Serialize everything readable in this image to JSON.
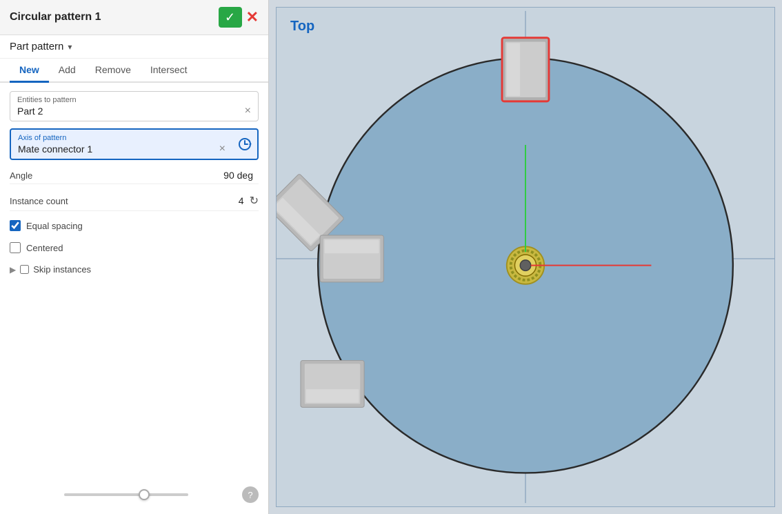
{
  "panel": {
    "title": "Circular pattern 1",
    "confirm_label": "✓",
    "cancel_label": "✗",
    "dropdown_label": "Part pattern",
    "tabs": [
      {
        "id": "new",
        "label": "New",
        "active": true
      },
      {
        "id": "add",
        "label": "Add",
        "active": false
      },
      {
        "id": "remove",
        "label": "Remove",
        "active": false
      },
      {
        "id": "intersect",
        "label": "Intersect",
        "active": false
      }
    ],
    "entities_field": {
      "label": "Entities to pattern",
      "value": "Part 2"
    },
    "axis_field": {
      "label": "Axis of pattern",
      "value": "Mate connector 1"
    },
    "angle": {
      "label": "Angle",
      "value": "90 deg"
    },
    "instance_count": {
      "label": "Instance count",
      "value": "4"
    },
    "equal_spacing": {
      "label": "Equal spacing",
      "checked": true
    },
    "centered": {
      "label": "Centered",
      "checked": false
    },
    "skip_instances": {
      "label": "Skip instances",
      "checked": false
    }
  },
  "canvas": {
    "label": "Top"
  },
  "icons": {
    "check": "✓",
    "close": "✕",
    "dropdown_arrow": "▾",
    "clear": "×",
    "clock": "⏱",
    "refresh": "↻",
    "help": "?"
  }
}
